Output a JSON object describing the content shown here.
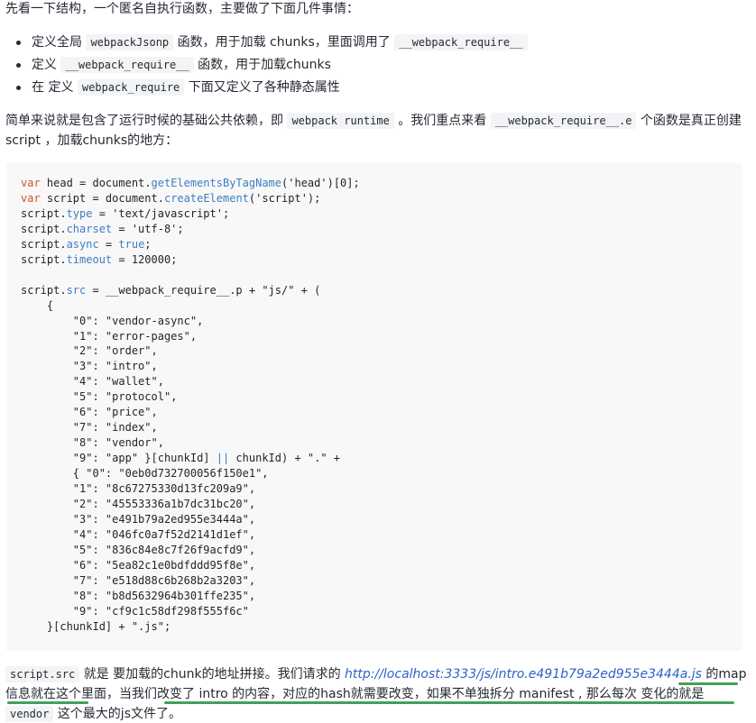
{
  "intro": "先看一下结构，一个匿名自执行函数，主要做了下面几件事情：",
  "bullets": [
    {
      "pre": "定义全局 ",
      "code": "webpackJsonp",
      "mid": " 函数，用于加载 chunks，里面调用了 ",
      "code2": "__webpack_require__",
      "post": ""
    },
    {
      "pre": "定义 ",
      "code": "__webpack_require__",
      "mid": " 函数，用于加载chunks",
      "code2": "",
      "post": ""
    },
    {
      "pre": "在 定义 ",
      "code": "webpack_require",
      "mid": " 下面又定义了各种静态属性",
      "code2": "",
      "post": ""
    }
  ],
  "para2": {
    "a": "简单来说就是包含了运行时候的基础公共依赖，即 ",
    "code1": "webpack runtime",
    "b": " 。我们重点来看 ",
    "code2": "__webpack_require__.e",
    "c": " 个函数是真正创建 script ，加载chunks的地方："
  },
  "code_lines": [
    "var head = document.getElementsByTagName('head')[0];",
    "var script = document.createElement('script');",
    "script.type = 'text/javascript';",
    "script.charset = 'utf-8';",
    "script.async = true;",
    "script.timeout = 120000;",
    "",
    "script.src = __webpack_require__.p + \"js/\" + (",
    "    {",
    "        \"0\": \"vendor-async\",",
    "        \"1\": \"error-pages\",",
    "        \"2\": \"order\",",
    "        \"3\": \"intro\",",
    "        \"4\": \"wallet\",",
    "        \"5\": \"protocol\",",
    "        \"6\": \"price\",",
    "        \"7\": \"index\",",
    "        \"8\": \"vendor\",",
    "        \"9\": \"app\" }[chunkId] || chunkId) + \".\" +",
    "        { \"0\": \"0eb0d732700056f150e1\",",
    "        \"1\": \"8c67275330d13fc209a9\",",
    "        \"2\": \"45553336a1b7dc31bc20\",",
    "        \"3\": \"e491b79a2ed955e3444a\",",
    "        \"4\": \"046fc0a7f52d2141d1ef\",",
    "        \"5\": \"836c84e8c7f26f9acfd9\",",
    "        \"6\": \"5ea82c1e0bdfddd95f8e\",",
    "        \"7\": \"e518d88c6b268b2a3203\",",
    "        \"8\": \"b8d5632964b301ffe235\",",
    "        \"9\": \"cf9c1c58df298f555f6c\"",
    "    }[chunkId] + \".js\";"
  ],
  "para3": {
    "code1": "script.src",
    "a": " 就是 要加载的chunk的地址拼接。我们请求的 ",
    "link": "http://localhost:3333/js/intro.e491b79a2ed955e3444a.js",
    "b": " 的map信息就在这个里面，当我们改变了 intro 的内容，对应的hash就需要改变，如果不单独拆分 manifest , 那么每次 变化的就是 ",
    "code2": "vendor",
    "c": " 这个最大的js文件了。"
  },
  "colors": {
    "highlight_underline": "#44a05a",
    "link": "#2d62c7",
    "keyword": "#c9562c",
    "function": "#3e7dc0"
  }
}
